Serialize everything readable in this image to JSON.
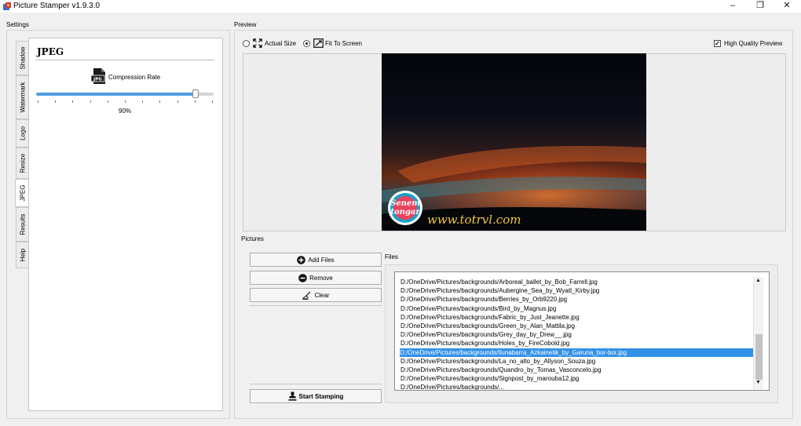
{
  "window": {
    "title": "Picture Stamper v1.9.3.0",
    "minimize": "–",
    "maximize": "❐",
    "close": "✕"
  },
  "settings": {
    "group_label": "Settings",
    "tabs": [
      "Shadow",
      "Watermark",
      "Logo",
      "Resize",
      "JPEG",
      "Results",
      "Help"
    ],
    "active_tab": "JPEG",
    "jpeg": {
      "title": "JPEG",
      "icon_text": "JPG",
      "compression_label": "Compression Rate",
      "compression_value": 90,
      "compression_text": "90%"
    }
  },
  "preview": {
    "group_label": "Preview",
    "actual_size": "Actual Size",
    "fit_to_screen": "Fit To Screen",
    "selected_mode": "fit_to_screen",
    "high_quality": "High Quality Preview",
    "high_quality_checked": true,
    "watermark_text": "www.totrvl.com",
    "logo_text_1": "Senem",
    "logo_text_2": "tongar"
  },
  "pictures": {
    "group_label": "Pictures",
    "add_files": "Add Files",
    "remove": "Remove",
    "clear": "Clear",
    "start_stamping": "Start Stamping",
    "files_label": "Files",
    "files": [
      "D:/OneDrive/Pictures/backgrounds/Arboreal_ballet_by_Bob_Farrell.jpg",
      "D:/OneDrive/Pictures/backgrounds/Aubergine_Sea_by_Wyatt_Kirby.jpg",
      "D:/OneDrive/Pictures/backgrounds/Berries_by_Orb9220.jpg",
      "D:/OneDrive/Pictures/backgrounds/Bird_by_Magnus.jpg",
      "D:/OneDrive/Pictures/backgrounds/Fabric_by_Just_Jeanette.jpg",
      "D:/OneDrive/Pictures/backgrounds/Green_by_Alan_Mattila.jpg",
      "D:/OneDrive/Pictures/backgrounds/Grey_day_by_Drew__.jpg",
      "D:/OneDrive/Pictures/backgrounds/Holes_by_FireCobold.jpg",
      "D:/OneDrive/Pictures/backgrounds/Ilunabarra_Azkainetik_by_Garuna_bor-bor.jpg",
      "D:/OneDrive/Pictures/backgrounds/La_no_alto_by_Allyson_Souza.jpg",
      "D:/OneDrive/Pictures/backgrounds/Quandro_by_Tomas_Vasconcelo.jpg",
      "D:/OneDrive/Pictures/backgrounds/Signpost_by_marouba12.jpg",
      "D:/OneDrive/Pictures/backgrounds/..."
    ],
    "selected_index": 8
  }
}
